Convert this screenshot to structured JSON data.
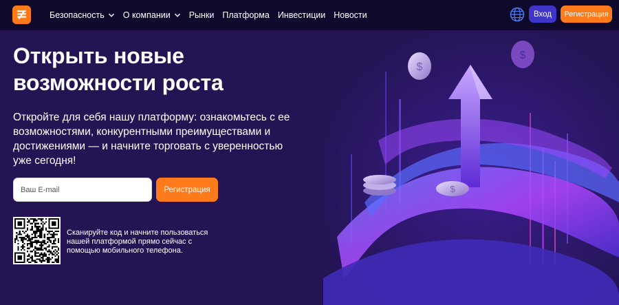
{
  "header": {
    "nav": [
      {
        "label": "Безопасность",
        "dropdown": true,
        "icon": "chevron-down-icon"
      },
      {
        "label": "О компании",
        "dropdown": true,
        "icon": "chevron-down-icon"
      },
      {
        "label": "Рынки",
        "dropdown": false
      },
      {
        "label": "Платформа",
        "dropdown": false
      },
      {
        "label": "Инвестиции",
        "dropdown": false
      },
      {
        "label": "Новости",
        "dropdown": false
      }
    ],
    "language_icon": "globe-icon",
    "login_label": "Вход",
    "register_label": "Регистрация"
  },
  "hero": {
    "title_line1": "Открыть новые",
    "title_line2": "возможности роста",
    "subtitle": "Откройте для себя нашу платформу: ознакомьтесь с ее возможностями, конкурентными преимуществами и достижениями — и начните торговать с уверенностью уже сегодня!",
    "email_placeholder": "Ваш E-mail",
    "register_label": "Регистрация",
    "qr_text": "Сканируйте код и начните пользоваться нашей платформой прямо сейчас с помощью мобильного телефона."
  },
  "colors": {
    "header_bg": "#0f0a2b",
    "page_bg": "#241454",
    "accent_orange": "#ff7a1a",
    "login_blue": "#3f35c9"
  }
}
